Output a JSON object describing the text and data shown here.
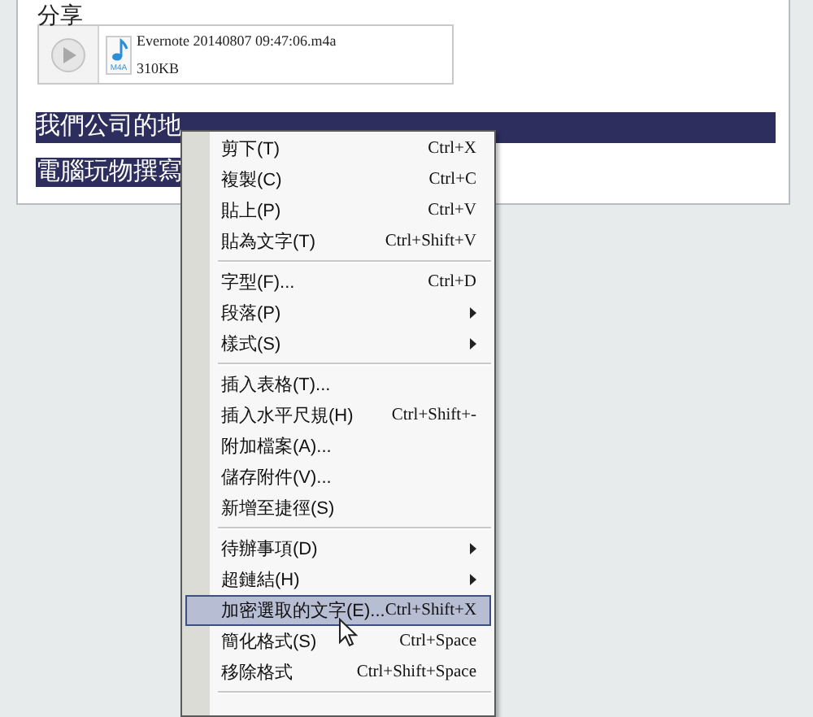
{
  "note": {
    "heading": "分享",
    "attachment": {
      "file_type": "M4A",
      "file_name": "Evernote 20140807 09:47:06.m4a",
      "size": "310KB"
    },
    "lines": [
      {
        "text": "我們公司的地",
        "selected": true
      },
      {
        "text": "電腦玩物撰寫",
        "selected": true
      }
    ]
  },
  "context_menu": {
    "items": [
      {
        "kind": "item",
        "label": "剪下(T)",
        "shortcut": "Ctrl+X",
        "submenu": false,
        "selected": false
      },
      {
        "kind": "item",
        "label": "複製(C)",
        "shortcut": "Ctrl+C",
        "submenu": false,
        "selected": false
      },
      {
        "kind": "item",
        "label": "貼上(P)",
        "shortcut": "Ctrl+V",
        "submenu": false,
        "selected": false
      },
      {
        "kind": "item",
        "label": "貼為文字(T)",
        "shortcut": "Ctrl+Shift+V",
        "submenu": false,
        "selected": false
      },
      {
        "kind": "separator"
      },
      {
        "kind": "item",
        "label": "字型(F)...",
        "shortcut": "Ctrl+D",
        "submenu": false,
        "selected": false
      },
      {
        "kind": "item",
        "label": "段落(P)",
        "submenu": true,
        "selected": false
      },
      {
        "kind": "item",
        "label": "樣式(S)",
        "submenu": true,
        "selected": false
      },
      {
        "kind": "separator"
      },
      {
        "kind": "item",
        "label": "插入表格(T)...",
        "submenu": false,
        "selected": false
      },
      {
        "kind": "item",
        "label": "插入水平尺規(H)",
        "shortcut": "Ctrl+Shift+-",
        "submenu": false,
        "selected": false
      },
      {
        "kind": "item",
        "label": "附加檔案(A)...",
        "submenu": false,
        "selected": false
      },
      {
        "kind": "item",
        "label": "儲存附件(V)...",
        "submenu": false,
        "selected": false
      },
      {
        "kind": "item",
        "label": "新增至捷徑(S)",
        "submenu": false,
        "selected": false
      },
      {
        "kind": "separator"
      },
      {
        "kind": "item",
        "label": "待辦事項(D)",
        "submenu": true,
        "selected": false
      },
      {
        "kind": "item",
        "label": "超鏈結(H)",
        "submenu": true,
        "selected": false
      },
      {
        "kind": "item",
        "label": "加密選取的文字(E)...",
        "shortcut": "Ctrl+Shift+X",
        "submenu": false,
        "selected": true
      },
      {
        "kind": "item",
        "label": "簡化格式(S)",
        "shortcut": "Ctrl+Space",
        "submenu": false,
        "selected": false
      },
      {
        "kind": "item",
        "label": "移除格式",
        "shortcut": "Ctrl+Shift+Space",
        "submenu": false,
        "selected": false
      },
      {
        "kind": "separator"
      }
    ]
  }
}
